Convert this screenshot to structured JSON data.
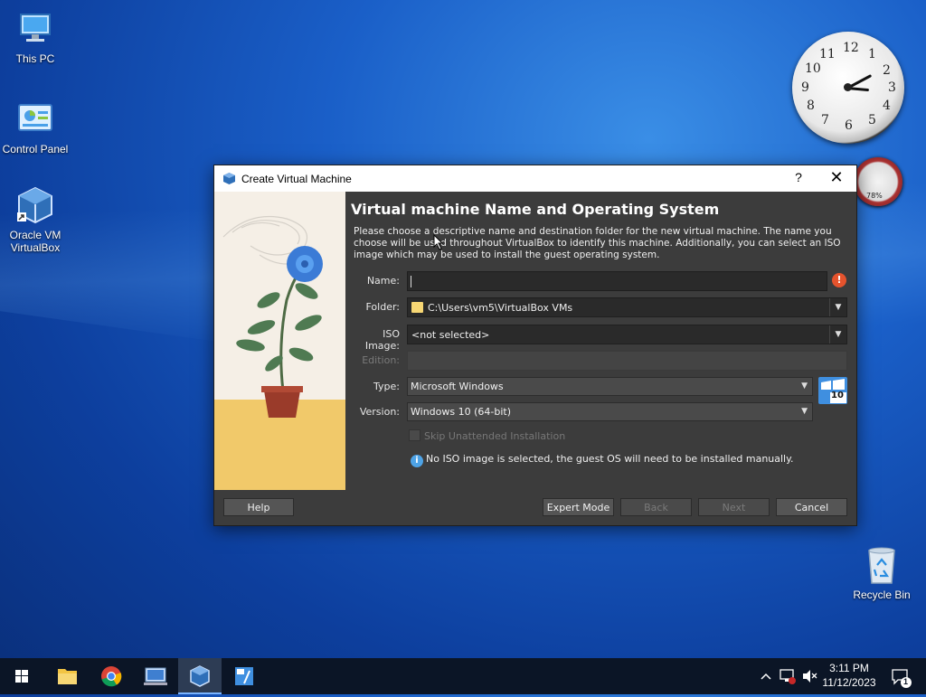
{
  "desktop": {
    "icons": [
      {
        "label": "This PC"
      },
      {
        "label": "Control Panel"
      },
      {
        "label": "Oracle VM VirtualBox"
      }
    ],
    "recycle_bin": "Recycle Bin",
    "meter_value": "78%"
  },
  "dialog": {
    "title": "Create Virtual Machine",
    "help_glyph": "?",
    "close_glyph": "✕",
    "heading": "Virtual machine Name and Operating System",
    "description": "Please choose a descriptive name and destination folder for the new virtual machine. The name you choose will be used throughout VirtualBox to identify this machine. Additionally, you can select an ISO image which may be used to install the guest operating system.",
    "fields": {
      "name_label": "Name:",
      "name_value": "",
      "folder_label": "Folder:",
      "folder_value": "C:\\Users\\vm5\\VirtualBox VMs",
      "iso_label": "ISO Image:",
      "iso_value": "<not selected>",
      "edition_label": "Edition:",
      "edition_value": "",
      "type_label": "Type:",
      "type_value": "Microsoft Windows",
      "version_label": "Version:",
      "version_value": "Windows 10 (64-bit)"
    },
    "skip_unattended": "Skip Unattended Installation",
    "info_message": "No ISO image is selected, the guest OS will need to be installed manually.",
    "os_badge": "10",
    "buttons": {
      "help": "Help",
      "expert": "Expert Mode",
      "back": "Back",
      "next": "Next",
      "cancel": "Cancel"
    }
  },
  "taskbar": {
    "time": "3:11 PM",
    "date": "11/12/2023",
    "notifications": "1"
  }
}
